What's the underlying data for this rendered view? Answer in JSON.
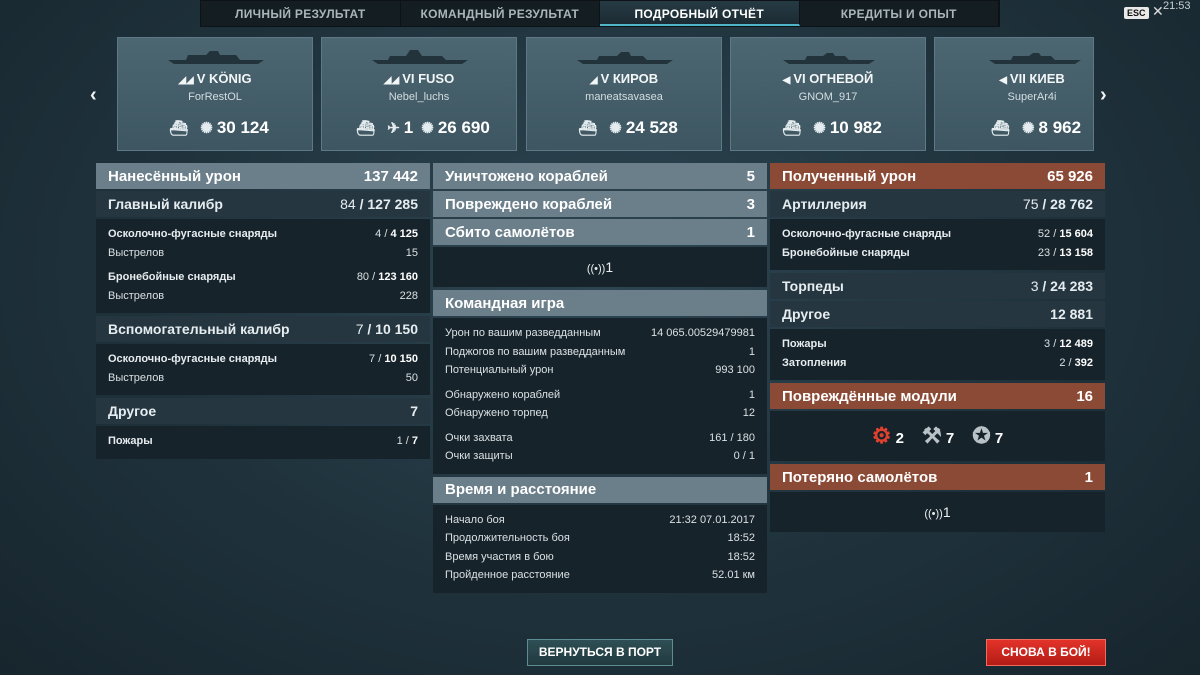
{
  "tabs": [
    "ЛИЧНЫЙ РЕЗУЛЬТАТ",
    "КОМАНДНЫЙ РЕЗУЛЬТАТ",
    "ПОДРОБНЫЙ ОТЧЁТ",
    "КРЕДИТЫ И ОПЫТ"
  ],
  "esc_label": "ESC",
  "clock": "21:53",
  "nav": {
    "prev": "‹",
    "next": "›"
  },
  "ships": [
    {
      "tier_name": "V KÖNIG",
      "player": "ForRestOL",
      "planes": "",
      "damage": "30 124"
    },
    {
      "tier_name": "VI FUSO",
      "player": "Nebel_luchs",
      "planes": "1",
      "damage": "26 690"
    },
    {
      "tier_name": "V КИРОВ",
      "player": "maneatsavasea",
      "planes": "",
      "damage": "24 528"
    },
    {
      "tier_name": "VI ОГНЕВОЙ",
      "player": "GNOM_917",
      "planes": "",
      "damage": "10 982"
    },
    {
      "tier_name": "VII КИЕВ",
      "player": "SuperAr4i",
      "planes": "",
      "damage": "8 962"
    }
  ],
  "left": {
    "header": {
      "label": "Нанесённый урон",
      "value": "137 442"
    },
    "main": {
      "label": "Главный калибр",
      "hits": "84",
      "value": "127 285",
      "he_label": "Осколочно-фугасные снаряды",
      "he_hits": "4",
      "he_value": "4 125",
      "he_shots_label": "Выстрелов",
      "he_shots": "15",
      "ap_label": "Бронебойные снаряды",
      "ap_hits": "80",
      "ap_value": "123 160",
      "ap_shots_label": "Выстрелов",
      "ap_shots": "228"
    },
    "secondary": {
      "label": "Вспомогательный калибр",
      "hits": "7",
      "value": "10 150",
      "he_label": "Осколочно-фугасные снаряды",
      "he_hits": "7",
      "he_value": "10 150",
      "shots_label": "Выстрелов",
      "shots": "50"
    },
    "other": {
      "label": "Другое",
      "value": "7",
      "fires_label": "Пожары",
      "fires_hits": "1",
      "fires_value": "7"
    }
  },
  "middle": {
    "destroyed": {
      "label": "Уничтожено кораблей",
      "value": "5"
    },
    "damaged": {
      "label": "Повреждено кораблей",
      "value": "3"
    },
    "planes": {
      "label": "Сбито самолётов",
      "value": "1",
      "count": "1"
    },
    "team": {
      "label": "Командная игра",
      "rows": [
        {
          "k": "Урон по вашим разведданным",
          "v": "14 065.00529479981"
        },
        {
          "k": "Поджогов по вашим разведданным",
          "v": "1"
        },
        {
          "k": "Потенциальный урон",
          "v": "993 100"
        },
        {
          "k": "Обнаружено кораблей",
          "v": "1"
        },
        {
          "k": "Обнаружено торпед",
          "v": "12"
        },
        {
          "k": "Очки захвата",
          "v": "161 / 180"
        },
        {
          "k": "Очки защиты",
          "v": "0 / 1"
        }
      ]
    },
    "time": {
      "label": "Время и расстояние",
      "rows": [
        {
          "k": "Начало боя",
          "v": "21:32  07.01.2017"
        },
        {
          "k": "Продолжительность боя",
          "v": "18:52"
        },
        {
          "k": "Время участия в бою",
          "v": "18:52"
        },
        {
          "k": "Пройденное расстояние",
          "v": "52.01 км"
        }
      ]
    }
  },
  "right": {
    "header": {
      "label": "Полученный урон",
      "value": "65 926"
    },
    "artillery": {
      "label": "Артиллерия",
      "hits": "75",
      "value": "28 762",
      "he_label": "Осколочно-фугасные снаряды",
      "he_hits": "52",
      "he_value": "15 604",
      "ap_label": "Бронебойные снаряды",
      "ap_hits": "23",
      "ap_value": "13 158"
    },
    "torpedoes": {
      "label": "Торпеды",
      "hits": "3",
      "value": "24 283"
    },
    "other": {
      "label": "Другое",
      "value": "12 881",
      "fires_label": "Пожары",
      "fires_hits": "3",
      "fires_value": "12 489",
      "flood_label": "Затопления",
      "flood_hits": "2",
      "flood_value": "392"
    },
    "modules": {
      "label": "Повреждённые модули",
      "value": "16",
      "items": [
        {
          "icon": "engine-icon",
          "count": "2"
        },
        {
          "icon": "steering-icon",
          "count": "7"
        },
        {
          "icon": "turret-icon",
          "count": "7"
        }
      ]
    },
    "planes_lost": {
      "label": "Потеряно самолётов",
      "value": "1",
      "count": "1"
    }
  },
  "buttons": {
    "port": "ВЕРНУТЬСЯ В ПОРТ",
    "battle": "СНОВА В БОЙ!"
  }
}
